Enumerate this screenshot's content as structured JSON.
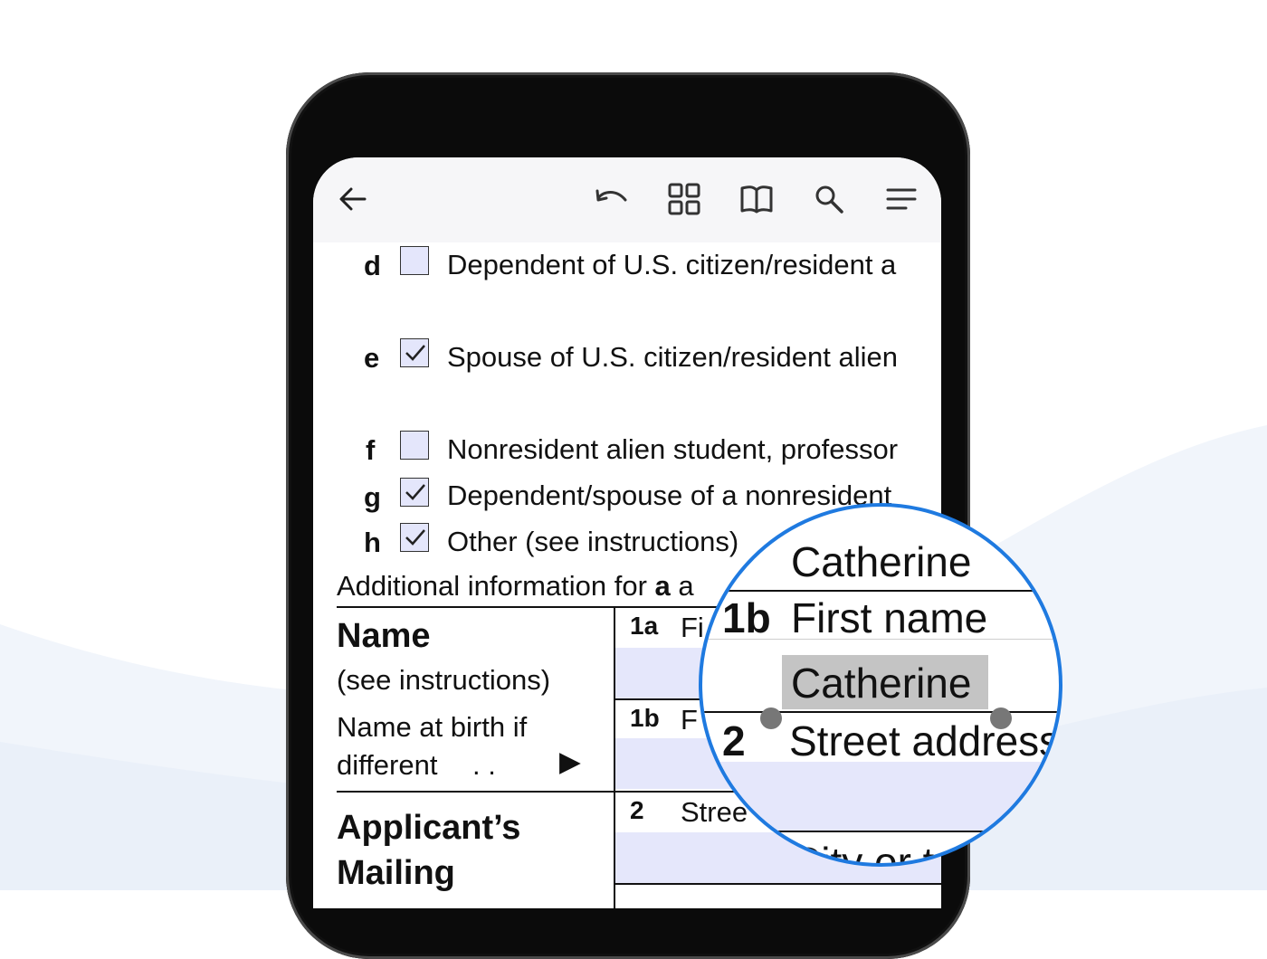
{
  "toolbar": {
    "back_icon": "arrow-left-icon",
    "undo_icon": "undo-icon",
    "grid_icon": "grid-icon",
    "book_icon": "book-icon",
    "search_icon": "search-icon",
    "menu_icon": "menu-icon"
  },
  "options": [
    {
      "letter": "d",
      "text": "Dependent of U.S. citizen/resident a",
      "checked": false
    },
    {
      "letter": "e",
      "text": "Spouse of U.S. citizen/resident alien",
      "checked": true
    },
    {
      "letter": "f",
      "text": "Nonresident alien student, professor",
      "checked": false
    },
    {
      "letter": "g",
      "text": "Dependent/spouse of a nonresident",
      "checked": true
    },
    {
      "letter": "h",
      "text": "Other (see instructions)",
      "checked": true
    }
  ],
  "info_line": {
    "text": "Additional information for ",
    "bold": "a",
    "tail": " a"
  },
  "name_section": {
    "title": "Name",
    "subtitle": "(see instructions)",
    "birth_line1": "Name at birth if",
    "birth_line2": "different",
    "dots": ".  .",
    "arrow": "▶"
  },
  "mailing_section": {
    "title_line1": "Applicant’s",
    "title_line2": "Mailing"
  },
  "fields": [
    {
      "num": "1a",
      "label": "Fi"
    },
    {
      "num": "1b",
      "label": "F"
    },
    {
      "num": "2",
      "label": "Stree"
    }
  ],
  "magnifier": {
    "top_value": "Catherine",
    "field_1b_num": "1b",
    "field_1b_label": "First name",
    "selected_value": "Catherine",
    "field_2_num": "2",
    "field_2_label": "Street address",
    "bottom_label": "City or to"
  },
  "colors": {
    "accent": "#1f7ae0",
    "field_fill": "#e5e7fb",
    "selection": "#c4c4c4"
  }
}
